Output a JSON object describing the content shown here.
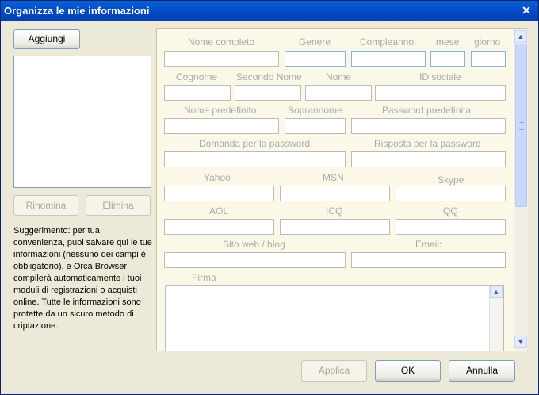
{
  "window": {
    "title": "Organizza le mie informazioni",
    "close_glyph": "✕"
  },
  "left": {
    "add_label": "Aggiungi",
    "rename_label": "Rinomina",
    "delete_label": "Elimina",
    "hint": "Suggerimento: per tua convenienza, puoi salvare qui le tue informazioni (nessuno dei campi è obbligatorio), e Orca Browser compilerà automaticamente i tuoi moduli di registrazioni o acquisti online. Tutte le informazioni sono protette da un sicuro metodo di criptazione."
  },
  "form": {
    "full_name": "Nome completo",
    "gender": "Genere",
    "birthday": "Compleanno:",
    "month": "mese",
    "day": "giorno",
    "surname": "Cognome",
    "middle_name": "Secondo Nome",
    "first_name": "Nome",
    "social_id": "ID sociale",
    "default_name": "Nome predefinito",
    "nickname": "Soprannome",
    "default_password": "Password predefinita",
    "password_question": "Domanda per la password",
    "password_answer": "Risposta per la password",
    "yahoo": "Yahoo",
    "msn": "MSN",
    "skype": "Skype",
    "aol": "AOL",
    "icq": "ICQ",
    "qq": "QQ",
    "website": "Sito web / blog",
    "email": "Email:",
    "signature": "Firma"
  },
  "footer": {
    "apply_label": "Applica",
    "ok_label": "OK",
    "cancel_label": "Annulla"
  },
  "icons": {
    "close": "close-icon",
    "scroll_up": "scroll-up-arrow-icon",
    "scroll_down": "scroll-down-arrow-icon"
  }
}
